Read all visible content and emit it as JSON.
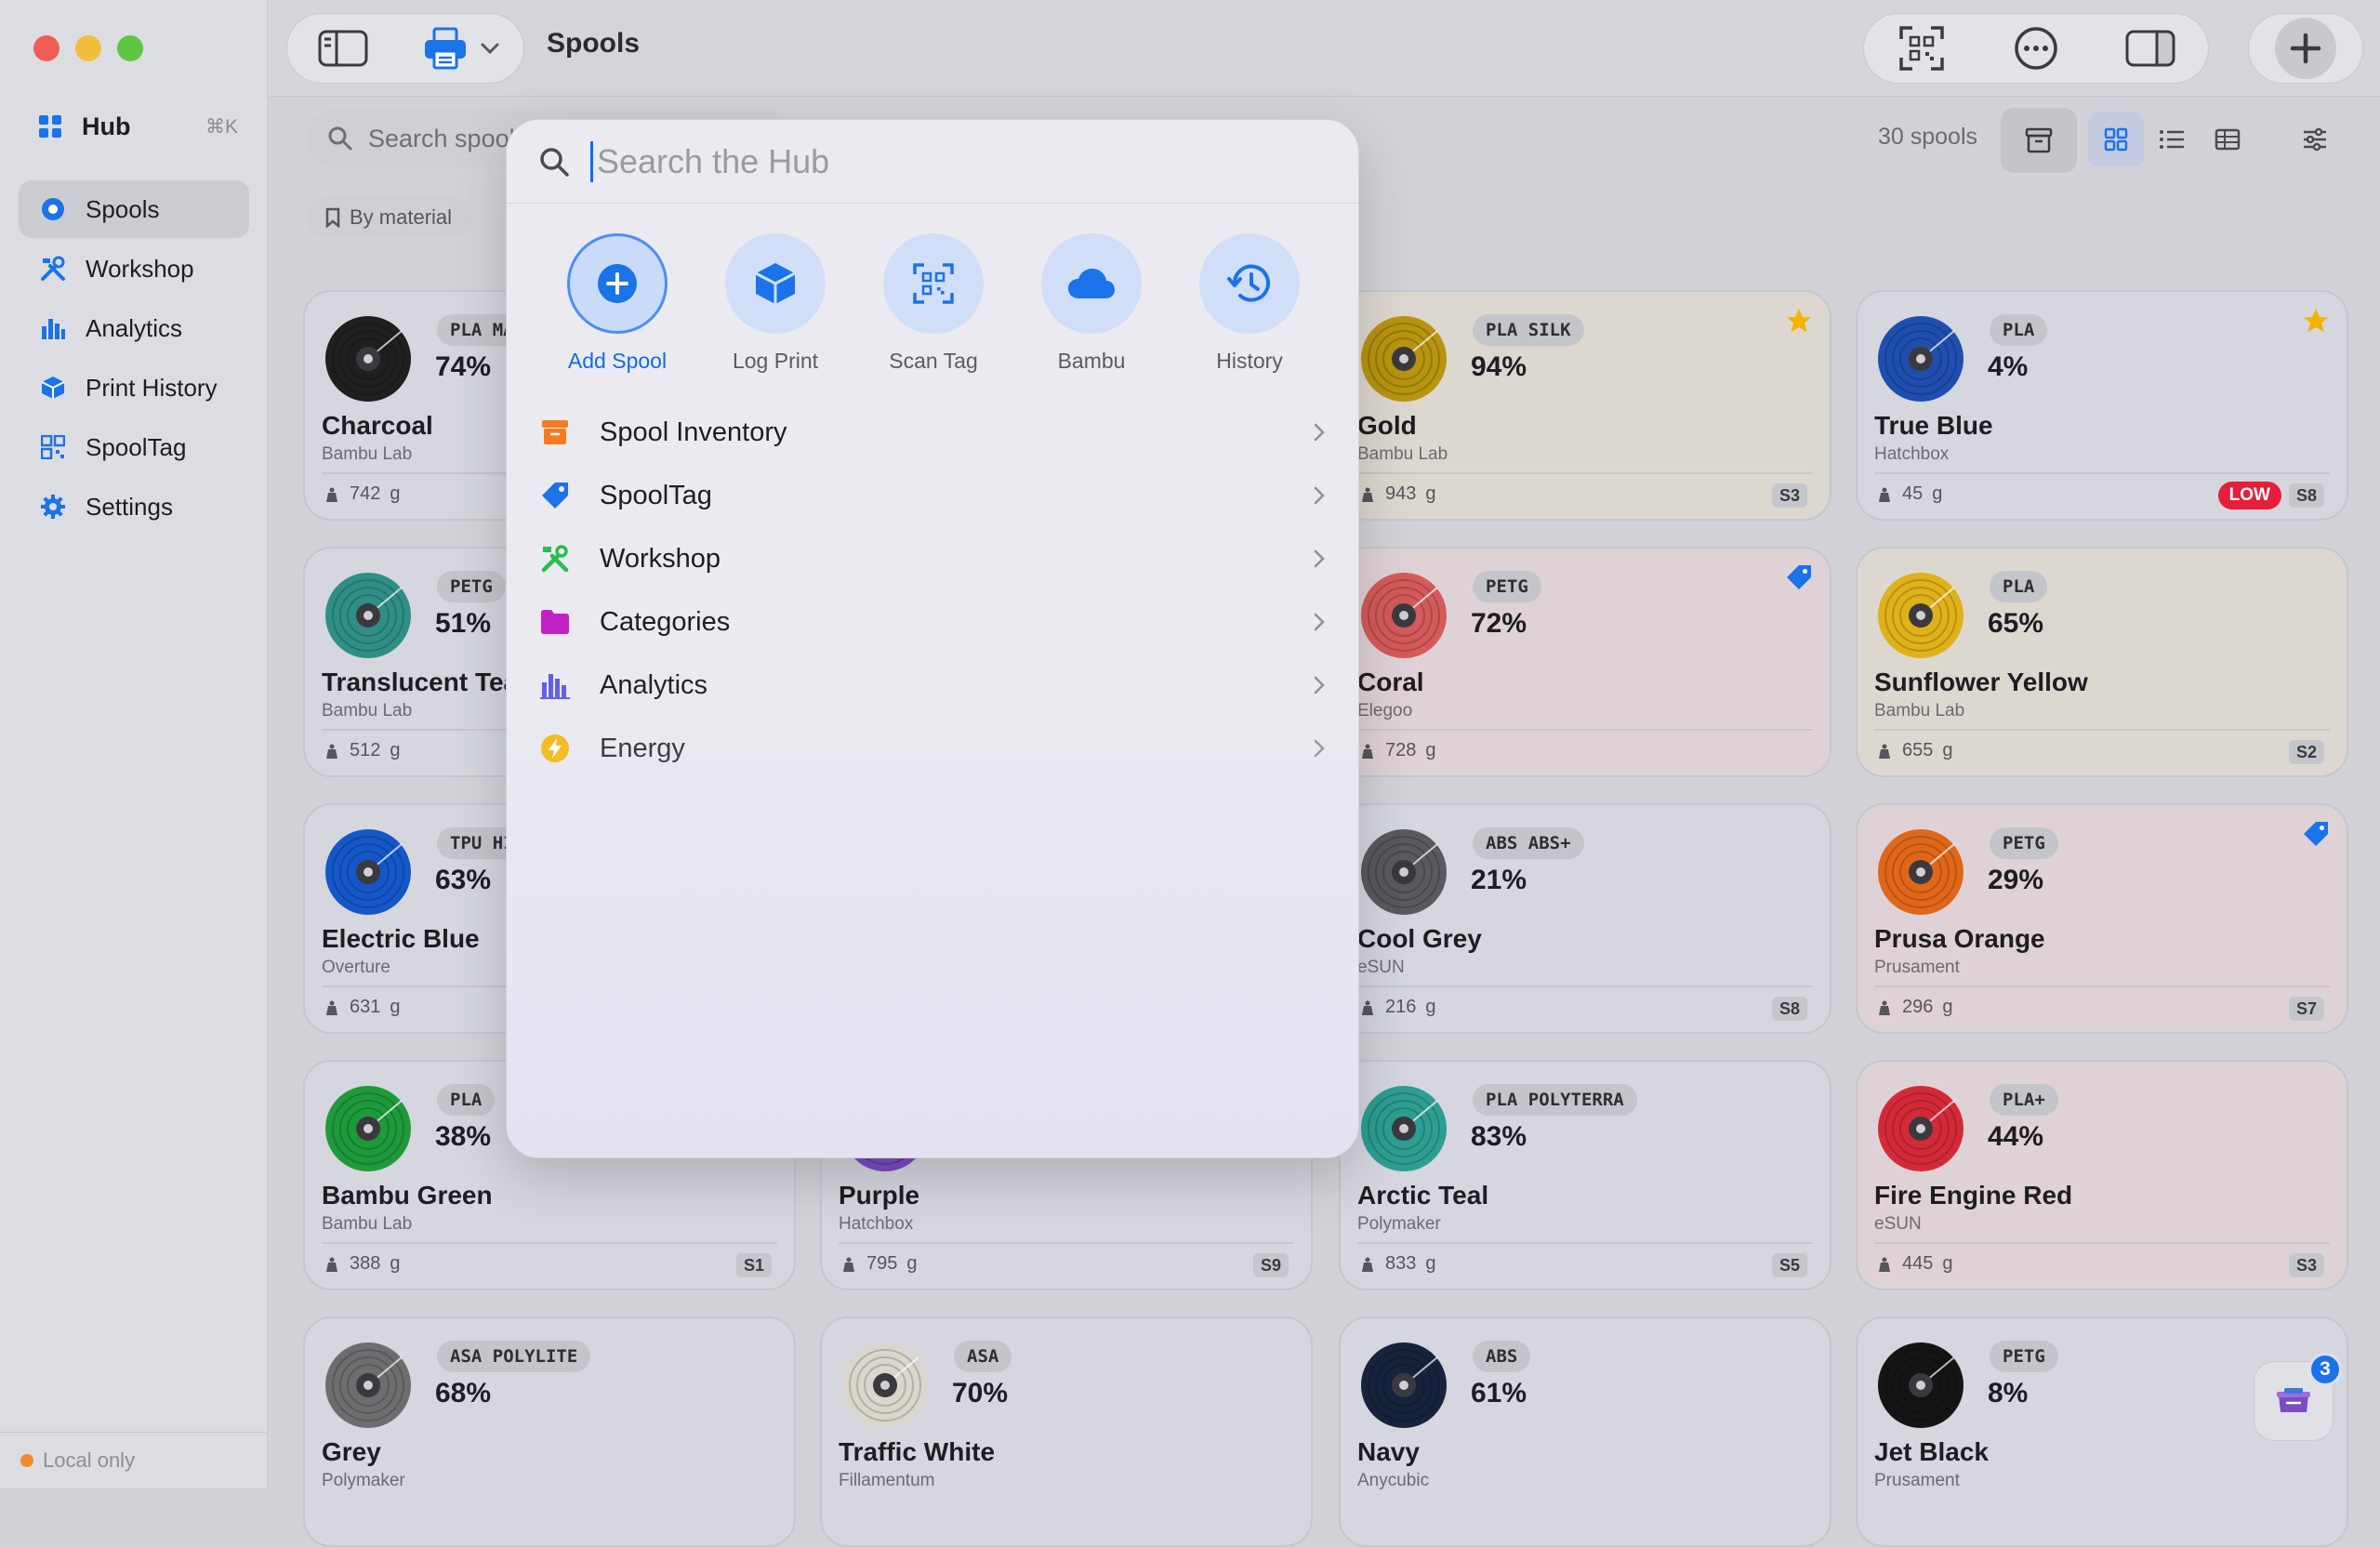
{
  "sidebar": {
    "hub_label": "Hub",
    "hub_shortcut": "⌘K",
    "items": [
      {
        "label": "Spools",
        "icon": "spool-icon",
        "active": true
      },
      {
        "label": "Workshop",
        "icon": "tools-icon"
      },
      {
        "label": "Analytics",
        "icon": "bar-chart-icon"
      },
      {
        "label": "Print History",
        "icon": "cube-icon"
      },
      {
        "label": "SpoolTag",
        "icon": "qr-icon"
      },
      {
        "label": "Settings",
        "icon": "gear-icon"
      }
    ],
    "status": "Local only"
  },
  "toolbar": {
    "title": "Spools"
  },
  "content": {
    "search_placeholder": "Search spools",
    "chip_label": "By material",
    "count_label": "30 spools"
  },
  "hub": {
    "search_placeholder": "Search the Hub",
    "actions": [
      {
        "label": "Add Spool",
        "icon": "plus-circle-icon"
      },
      {
        "label": "Log Print",
        "icon": "cube-icon"
      },
      {
        "label": "Scan Tag",
        "icon": "qr-scan-icon"
      },
      {
        "label": "Bambu",
        "icon": "cloud-icon"
      },
      {
        "label": "History",
        "icon": "history-icon"
      }
    ],
    "list": [
      {
        "label": "Spool Inventory",
        "icon": "archive-box-icon",
        "color": "#f47b20"
      },
      {
        "label": "SpoolTag",
        "icon": "tag-icon",
        "color": "#1a73e8"
      },
      {
        "label": "Workshop",
        "icon": "tools-icon",
        "color": "#2bbd4d"
      },
      {
        "label": "Categories",
        "icon": "folder-icon",
        "color": "#c322c7"
      },
      {
        "label": "Analytics",
        "icon": "bar-chart-icon",
        "color": "#5e5ce6"
      },
      {
        "label": "Energy",
        "icon": "bolt-icon",
        "color": "#f5b700"
      }
    ]
  },
  "cards": [
    {
      "name": "Charcoal",
      "brand": "Bambu Lab",
      "material": "PLA MA",
      "percent": "74%",
      "weight": "742",
      "unit": "g",
      "slot": "",
      "color": "#1f1f1f",
      "tint": "cool"
    },
    {
      "name": "Gold",
      "brand": "Bambu Lab",
      "material": "PLA SILK",
      "percent": "94%",
      "weight": "943",
      "unit": "g",
      "slot": "S3",
      "color": "#b8940f",
      "tint": "warm",
      "star": true
    },
    {
      "name": "True Blue",
      "brand": "Hatchbox",
      "material": "PLA",
      "percent": "4%",
      "weight": "45",
      "unit": "g",
      "slot": "S8",
      "color": "#1e4fb0",
      "tint": "cool",
      "star": true,
      "low": "LOW"
    },
    {
      "name": "Translucent Tea",
      "brand": "Bambu Lab",
      "material": "PETG",
      "percent": "51%",
      "weight": "512",
      "unit": "g",
      "slot": "",
      "color": "#2f8f86",
      "tint": "cool"
    },
    {
      "name": "Coral",
      "brand": "Elegoo",
      "material": "PETG",
      "percent": "72%",
      "weight": "728",
      "unit": "g",
      "slot": "",
      "color": "#d55a5a",
      "tint": "pink",
      "tag": true
    },
    {
      "name": "Sunflower Yellow",
      "brand": "Bambu Lab",
      "material": "PLA",
      "percent": "65%",
      "weight": "655",
      "unit": "g",
      "slot": "S2",
      "color": "#e0b11a",
      "tint": "warm"
    },
    {
      "name": "Electric Blue",
      "brand": "Overture",
      "material": "TPU HI",
      "percent": "63%",
      "weight": "631",
      "unit": "g",
      "slot": "",
      "color": "#1357c9",
      "tint": "cool"
    },
    {
      "name": "Cool Grey",
      "brand": "eSUN",
      "material": "ABS ABS+",
      "percent": "21%",
      "weight": "216",
      "unit": "g",
      "slot": "S8",
      "color": "#5a5a5e",
      "tint": "cool"
    },
    {
      "name": "Prusa Orange",
      "brand": "Prusament",
      "material": "PETG",
      "percent": "29%",
      "weight": "296",
      "unit": "g",
      "slot": "S7",
      "color": "#e0671a",
      "tint": "pink",
      "tag": true
    },
    {
      "name": "Bambu Green",
      "brand": "Bambu Lab",
      "material": "PLA",
      "percent": "38%",
      "weight": "388",
      "unit": "g",
      "slot": "S1",
      "color": "#1f9a3a",
      "tint": "cool"
    },
    {
      "name": "Purple",
      "brand": "Hatchbox",
      "material": "",
      "percent": "",
      "weight": "795",
      "unit": "g",
      "slot": "S9",
      "color": "#7b4cc4",
      "tint": "cool"
    },
    {
      "name": "Arctic Teal",
      "brand": "Polymaker",
      "material": "PLA POLYTERRA",
      "percent": "83%",
      "weight": "833",
      "unit": "g",
      "slot": "S5",
      "color": "#2e9e93",
      "tint": "cool"
    },
    {
      "name": "Fire Engine Red",
      "brand": "eSUN",
      "material": "PLA+",
      "percent": "44%",
      "weight": "445",
      "unit": "g",
      "slot": "S3",
      "color": "#d42a38",
      "tint": "pink"
    },
    {
      "name": "Grey",
      "brand": "Polymaker",
      "material": "ASA POLYLITE",
      "percent": "68%",
      "weight": "",
      "unit": "",
      "slot": "",
      "color": "#6d6d70",
      "tint": "cool"
    },
    {
      "name": "Traffic White",
      "brand": "Fillamentum",
      "material": "ASA",
      "percent": "70%",
      "weight": "",
      "unit": "",
      "slot": "",
      "color": "#d9d6cc",
      "tint": "cool"
    },
    {
      "name": "Navy",
      "brand": "Anycubic",
      "material": "ABS",
      "percent": "61%",
      "weight": "",
      "unit": "",
      "slot": "",
      "color": "#17233d",
      "tint": "cool"
    },
    {
      "name": "Jet Black",
      "brand": "Prusament",
      "material": "PETG",
      "percent": "8%",
      "weight": "",
      "unit": "",
      "slot": "",
      "color": "#141414",
      "tint": "cool"
    }
  ],
  "fab_count": "3"
}
